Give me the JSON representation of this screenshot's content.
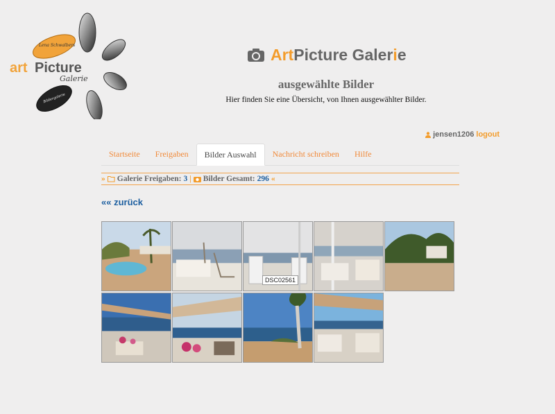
{
  "brand": {
    "art": "Art",
    "picture_gal": "Picture Galer",
    "i": "i",
    "e": "e"
  },
  "logo": {
    "art": "art",
    "picture": "Picture",
    "script1": "Lena Schwalbers",
    "script2": "Galerie",
    "script3": "Bildergalerie"
  },
  "page": {
    "title": "ausgewählte Bilder",
    "subtitle": "Hier finden Sie eine Übersicht, von Ihnen ausgewählter Bilder."
  },
  "user": {
    "name": "jensen1206",
    "logout": "logout"
  },
  "tabs": [
    {
      "label": "Startseite"
    },
    {
      "label": "Freigaben"
    },
    {
      "label": "Bilder Auswahl"
    },
    {
      "label": "Nachricht schreiben"
    },
    {
      "label": "Hilfe"
    }
  ],
  "info": {
    "left_arrows": "»",
    "freigaben_label": "Galerie Freigaben:",
    "freigaben_value": "3",
    "separator": "|",
    "gesamt_label": "Bilder Gesamt:",
    "gesamt_value": "296",
    "right_arrows": "«"
  },
  "back_label": "«« zurück",
  "tooltip": "DSC02561",
  "colors": {
    "accent": "#f39c2b",
    "link": "#1d5fa0",
    "background": "#efeeee"
  },
  "thumbnails": [
    {
      "scene": "pool"
    },
    {
      "scene": "sea-table"
    },
    {
      "scene": "sea-chairs"
    },
    {
      "scene": "terrace-lounge"
    },
    {
      "scene": "trees-beach"
    },
    {
      "scene": "umbrella-sea"
    },
    {
      "scene": "sail-flowers"
    },
    {
      "scene": "pine-beach"
    },
    {
      "scene": "restaurant-sea"
    }
  ]
}
